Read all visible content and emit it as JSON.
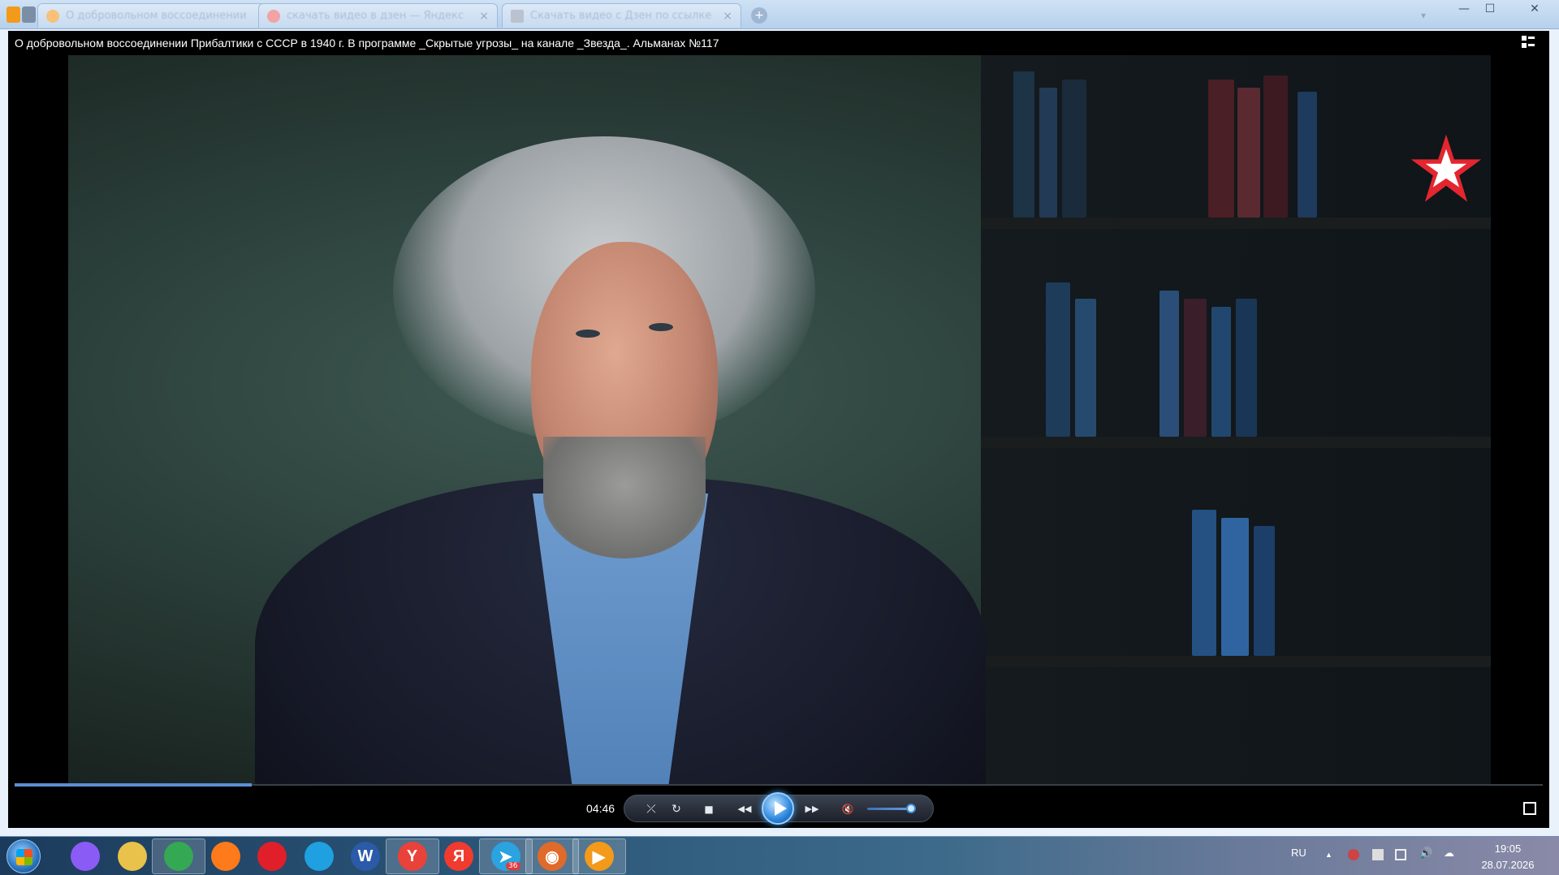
{
  "window": {
    "tabs": [
      {
        "label": "О добровольном воссоединении",
        "close": "×",
        "color": "#f39a1a"
      },
      {
        "label": "скачать видео в дзен — Яндекс",
        "close": "×",
        "color": "#f06a6a"
      },
      {
        "label": "Скачать видео с Дзен по ссылке",
        "close": "×",
        "color": "#9aa7b6"
      }
    ],
    "new_tab": "+",
    "tab_menu": "▾",
    "minimize": "—",
    "maximize": "☐",
    "close": "✕"
  },
  "player": {
    "title": "О добровольном воссоединении Прибалтики с СССР в 1940 г. В программе _Скрытые угрозы_ на канале _Звезда_. Альманах №117",
    "current_time": "04:46",
    "progress": 0.155,
    "volume": 0.9,
    "controls": {
      "ab_repeat": "⤫",
      "repeat": "↻",
      "stop": "■",
      "rewind": "◀◀",
      "forward": "▶▶",
      "mute": "🔇"
    }
  },
  "taskbar": {
    "apps": [
      {
        "name": "alice-icon",
        "glyph": "",
        "color": "#8a5cf5",
        "active": false
      },
      {
        "name": "explorer-icon",
        "glyph": "",
        "color": "#e8c24a",
        "active": false
      },
      {
        "name": "chrome-icon",
        "glyph": "",
        "color": "#34a853",
        "active": true
      },
      {
        "name": "firefox-icon",
        "glyph": "",
        "color": "#ff7a1a",
        "active": false
      },
      {
        "name": "opera-icon",
        "glyph": "",
        "color": "#e01f2b",
        "active": false
      },
      {
        "name": "edge-icon",
        "glyph": "",
        "color": "#1fa0e0",
        "active": false
      },
      {
        "name": "word-icon",
        "glyph": "W",
        "color": "#2b5aa8",
        "active": false
      },
      {
        "name": "yandex-browser-icon",
        "glyph": "Y",
        "color": "#e8423a",
        "active": true
      },
      {
        "name": "yandex-icon",
        "glyph": "Я",
        "color": "#f13b2e",
        "active": false
      },
      {
        "name": "telegram-icon",
        "glyph": "➤",
        "color": "#2aa3e0",
        "active": true,
        "badge": "36"
      },
      {
        "name": "eye-app-icon",
        "glyph": "◉",
        "color": "#e06a2a",
        "active": true
      },
      {
        "name": "media-player-icon",
        "glyph": "▶",
        "color": "#f39a1a",
        "active": true
      }
    ],
    "language": "RU",
    "tray_up": "▲",
    "time": "19:05",
    "date": "28.07.2026"
  }
}
